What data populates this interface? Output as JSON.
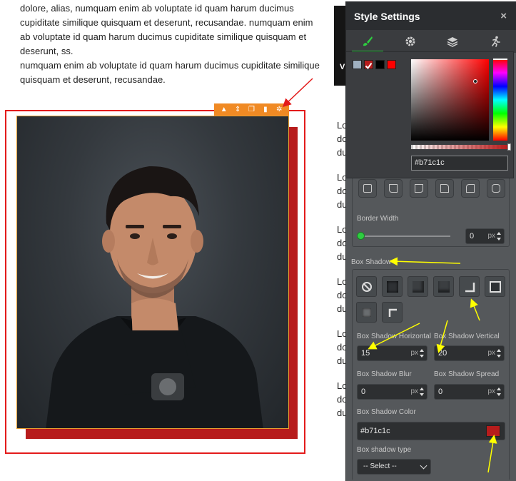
{
  "content": {
    "paragraph1": "dolore, alias, numquam enim ab voluptate id quam harum ducimus cupiditate similique quisquam et deserunt, recusandae. numquam enim ab voluptate id quam harum ducimus cupiditate similique quisquam et deserunt, ss.",
    "paragraph2": "numquam enim ab voluptate id quam harum ducimus cupiditate similique quisquam et deserunt, recusandae.",
    "image_toolbar": [
      "move-up",
      "move-vertical",
      "duplicate",
      "delete",
      "settings"
    ]
  },
  "background_column": {
    "strip_letter": "V",
    "fragments": [
      [
        "Lo",
        "do",
        "du"
      ],
      [
        "Lo",
        "do",
        "du"
      ],
      [
        "Lo",
        "do",
        "du"
      ],
      [
        "Lo",
        "do",
        "du"
      ],
      [
        "Lo",
        "do",
        "du"
      ],
      [
        "Lo",
        "do",
        "du"
      ]
    ]
  },
  "panel": {
    "title": "Style Settings",
    "close_label": "×",
    "tabs": [
      "brush",
      "gear",
      "layers",
      "animation"
    ],
    "active_tab": "brush",
    "color_picker": {
      "presets": [
        "#9fb0c0",
        "#b71c1c",
        "#000000",
        "#ff0000"
      ],
      "hex_value": "#b71c1c"
    },
    "border_width_label": "Border Width",
    "border_width_value": "0",
    "border_width_unit": "px",
    "box_shadow_section_label": "Box Shadow",
    "box_shadow_presets": [
      "none",
      "inset-all",
      "inset-bottom-right",
      "inset-bottom",
      "bottom-right",
      "outline",
      "inset-small",
      "top-left"
    ],
    "shadow_horizontal_label": "Box Shadow Horizontal",
    "shadow_horizontal_value": "15",
    "shadow_vertical_label": "Box Shadow Vertical",
    "shadow_vertical_value": "20",
    "shadow_blur_label": "Box Shadow Blur",
    "shadow_blur_value": "0",
    "shadow_spread_label": "Box Shadow Spread",
    "shadow_spread_value": "0",
    "unit": "px",
    "shadow_color_label": "Box Shadow Color",
    "shadow_color_value": "#b71c1c",
    "shadow_type_label": "Box shadow type",
    "shadow_type_value": "-- Select --"
  },
  "colors": {
    "accent_green": "#2ecc40",
    "frame_red": "#e31b1b",
    "shadow_red": "#b71c1c",
    "toolbar_orange": "#f08a24",
    "annotation_yellow": "#ffff00"
  }
}
